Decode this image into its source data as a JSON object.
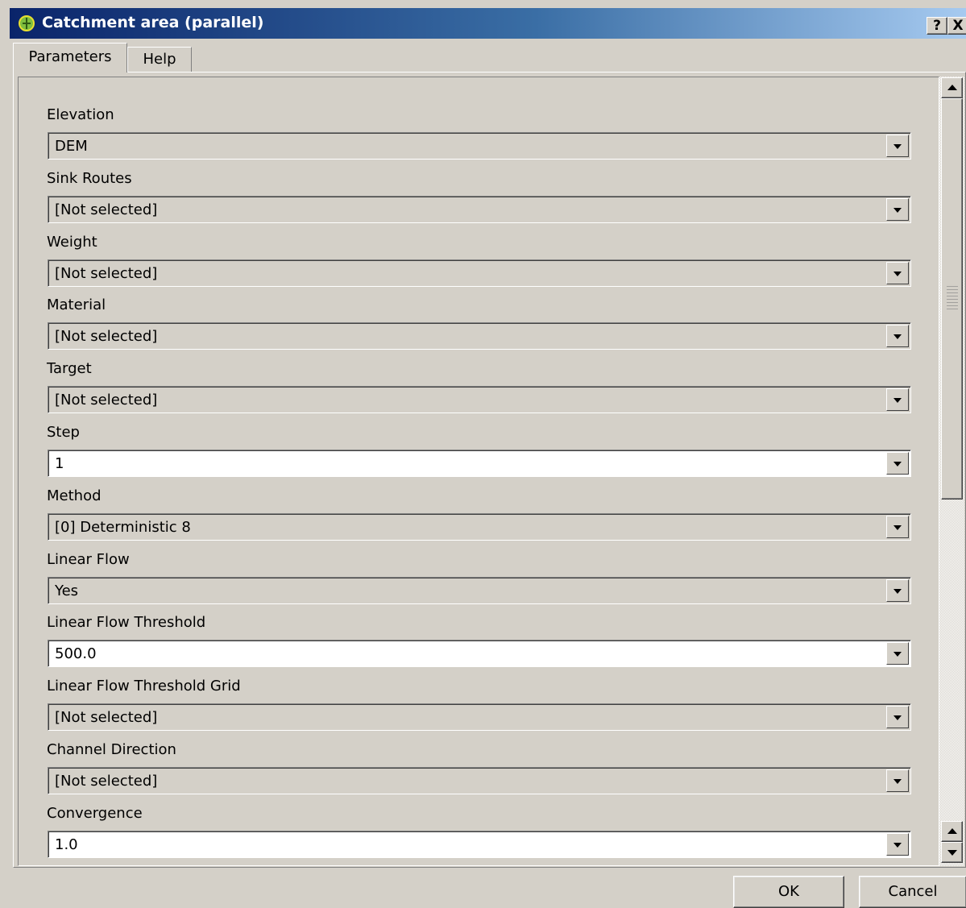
{
  "window": {
    "title": "Catchment area (parallel)",
    "help_button": "?",
    "close_button": "X"
  },
  "tabs": [
    {
      "label": "Parameters",
      "active": true
    },
    {
      "label": "Help",
      "active": false
    }
  ],
  "params": [
    {
      "label": "Elevation",
      "value": "DEM",
      "editable": false
    },
    {
      "label": "Sink Routes",
      "value": "[Not selected]",
      "editable": false
    },
    {
      "label": "Weight",
      "value": "[Not selected]",
      "editable": false
    },
    {
      "label": "Material",
      "value": "[Not selected]",
      "editable": false
    },
    {
      "label": "Target",
      "value": "[Not selected]",
      "editable": false
    },
    {
      "label": "Step",
      "value": "1",
      "editable": true
    },
    {
      "label": "Method",
      "value": "[0] Deterministic 8",
      "editable": false
    },
    {
      "label": "Linear Flow",
      "value": "Yes",
      "editable": false
    },
    {
      "label": "Linear Flow Threshold",
      "value": "500.0",
      "editable": true
    },
    {
      "label": "Linear Flow Threshold Grid",
      "value": "[Not selected]",
      "editable": false
    },
    {
      "label": "Channel Direction",
      "value": "[Not selected]",
      "editable": false
    },
    {
      "label": "Convergence",
      "value": "1.0",
      "editable": true
    }
  ],
  "buttons": {
    "ok": "OK",
    "cancel": "Cancel"
  }
}
